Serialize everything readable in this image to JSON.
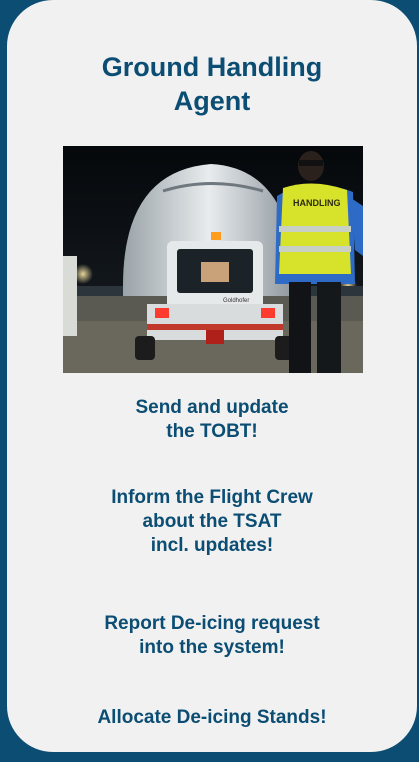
{
  "card": {
    "title_lines": [
      "Ground Handling",
      "Agent"
    ],
    "photo": {
      "vest_text": "HANDLING",
      "truck_text": "Goldhofer"
    },
    "tasks": [
      {
        "lines": [
          "Send and update",
          "the TOBT!"
        ]
      },
      {
        "lines": [
          "Inform the Flight Crew",
          "about the TSAT",
          "incl. updates!"
        ]
      },
      {
        "lines": [
          "Report De-icing request",
          "into the system!"
        ]
      },
      {
        "lines": [
          "Allocate De-icing Stands!"
        ]
      }
    ]
  },
  "colors": {
    "background": "#0b4d73",
    "card": "#f1f1f1",
    "text": "#0b4d73",
    "vest": "#d7e22a"
  }
}
